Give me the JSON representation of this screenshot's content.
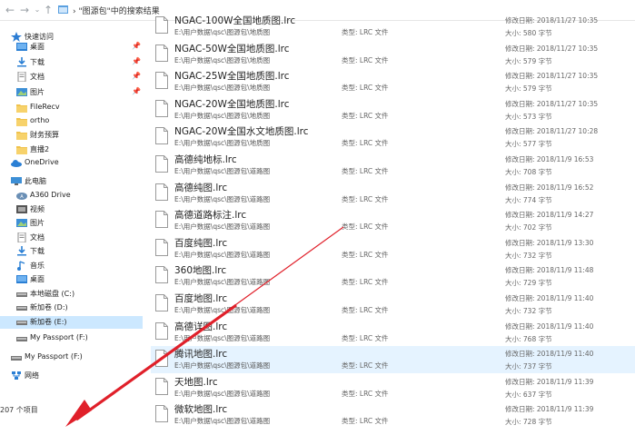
{
  "header": {
    "breadcrumb": "\"图源包\"中的搜索结果",
    "back_icon": "back-arrow-icon",
    "forward_icon": "forward-arrow-icon",
    "recent_icon": "chevron-down-icon",
    "up_icon": "up-arrow-icon"
  },
  "sidebar": {
    "quick_access": "快速访问",
    "items": [
      {
        "label": "桌面",
        "icon": "desktop-folder-icon",
        "pinned": true
      },
      {
        "label": "下载",
        "icon": "download-icon",
        "pinned": true
      },
      {
        "label": "文档",
        "icon": "documents-icon",
        "pinned": true
      },
      {
        "label": "图片",
        "icon": "pictures-icon",
        "pinned": true
      },
      {
        "label": "FileRecv",
        "icon": "folder-icon"
      },
      {
        "label": "ortho",
        "icon": "folder-icon"
      },
      {
        "label": "财务预算",
        "icon": "folder-icon"
      },
      {
        "label": "直播2",
        "icon": "folder-icon"
      },
      {
        "label": "OneDrive",
        "icon": "cloud-icon"
      },
      {
        "label": "此电脑",
        "icon": "computer-icon"
      },
      {
        "label": "A360 Drive",
        "icon": "a360-icon"
      },
      {
        "label": "视频",
        "icon": "video-icon"
      },
      {
        "label": "图片",
        "icon": "pictures-icon"
      },
      {
        "label": "文档",
        "icon": "documents-icon"
      },
      {
        "label": "下载",
        "icon": "download-icon"
      },
      {
        "label": "音乐",
        "icon": "music-icon"
      },
      {
        "label": "桌面",
        "icon": "desktop-folder-icon"
      },
      {
        "label": "本地磁盘 (C:)",
        "icon": "drive-icon"
      },
      {
        "label": "新加卷 (D:)",
        "icon": "drive-icon"
      },
      {
        "label": "新加卷 (E:)",
        "icon": "drive-icon",
        "selected": true
      },
      {
        "label": "My Passport (F:)",
        "icon": "drive-icon"
      },
      {
        "label": "My Passport (F:)",
        "icon": "drive-icon"
      },
      {
        "label": "网络",
        "icon": "network-icon"
      }
    ]
  },
  "status": {
    "count": "207 个项目"
  },
  "files": [
    {
      "name": "NGAC-100W全国地质图.lrc",
      "path": "E:\\用户数据\\qsc\\图源包\\地质图",
      "type": "类型: LRC 文件",
      "date": "修改日期: 2018/11/27 10:35",
      "size": "大小: 580 字节"
    },
    {
      "name": "NGAC-50W全国地质图.lrc",
      "path": "E:\\用户数据\\qsc\\图源包\\地质图",
      "type": "类型: LRC 文件",
      "date": "修改日期: 2018/11/27 10:35",
      "size": "大小: 579 字节"
    },
    {
      "name": "NGAC-25W全国地质图.lrc",
      "path": "E:\\用户数据\\qsc\\图源包\\地质图",
      "type": "类型: LRC 文件",
      "date": "修改日期: 2018/11/27 10:35",
      "size": "大小: 579 字节"
    },
    {
      "name": "NGAC-20W全国地质图.lrc",
      "path": "E:\\用户数据\\qsc\\图源包\\地质图",
      "type": "类型: LRC 文件",
      "date": "修改日期: 2018/11/27 10:35",
      "size": "大小: 573 字节"
    },
    {
      "name": "NGAC-20W全国水文地质图.lrc",
      "path": "E:\\用户数据\\qsc\\图源包\\地质图",
      "type": "类型: LRC 文件",
      "date": "修改日期: 2018/11/27 10:28",
      "size": "大小: 577 字节"
    },
    {
      "name": "高德纯地标.lrc",
      "path": "E:\\用户数据\\qsc\\图源包\\道路图",
      "type": "类型: LRC 文件",
      "date": "修改日期: 2018/11/9 16:53",
      "size": "大小: 708 字节"
    },
    {
      "name": "高德纯图.lrc",
      "path": "E:\\用户数据\\qsc\\图源包\\道路图",
      "type": "类型: LRC 文件",
      "date": "修改日期: 2018/11/9 16:52",
      "size": "大小: 774 字节"
    },
    {
      "name": "高德道路标注.lrc",
      "path": "E:\\用户数据\\qsc\\图源包\\道路图",
      "type": "类型: LRC 文件",
      "date": "修改日期: 2018/11/9 14:27",
      "size": "大小: 702 字节"
    },
    {
      "name": "百度纯图.lrc",
      "path": "E:\\用户数据\\qsc\\图源包\\道路图",
      "type": "类型: LRC 文件",
      "date": "修改日期: 2018/11/9 13:30",
      "size": "大小: 732 字节"
    },
    {
      "name": "360地图.lrc",
      "path": "E:\\用户数据\\qsc\\图源包\\道路图",
      "type": "类型: LRC 文件",
      "date": "修改日期: 2018/11/9 11:48",
      "size": "大小: 729 字节"
    },
    {
      "name": "百度地图.lrc",
      "path": "E:\\用户数据\\qsc\\图源包\\道路图",
      "type": "类型: LRC 文件",
      "date": "修改日期: 2018/11/9 11:40",
      "size": "大小: 732 字节"
    },
    {
      "name": "高德详图.lrc",
      "path": "E:\\用户数据\\qsc\\图源包\\道路图",
      "type": "类型: LRC 文件",
      "date": "修改日期: 2018/11/9 11:40",
      "size": "大小: 768 字节"
    },
    {
      "name": "腾讯地图.lrc",
      "path": "E:\\用户数据\\qsc\\图源包\\道路图",
      "type": "类型: LRC 文件",
      "date": "修改日期: 2018/11/9 11:40",
      "size": "大小: 737 字节",
      "selected": true
    },
    {
      "name": "天地图.lrc",
      "path": "E:\\用户数据\\qsc\\图源包\\道路图",
      "type": "类型: LRC 文件",
      "date": "修改日期: 2018/11/9 11:39",
      "size": "大小: 637 字节"
    },
    {
      "name": "微软地图.lrc",
      "path": "E:\\用户数据\\qsc\\图源包\\道路图",
      "type": "类型: LRC 文件",
      "date": "修改日期: 2018/11/9 11:39",
      "size": "大小: 728 字节"
    }
  ],
  "colors": {
    "selection": "#cce8ff",
    "row_selection": "#e5f3ff",
    "annotation_arrow": "#e0202a"
  }
}
